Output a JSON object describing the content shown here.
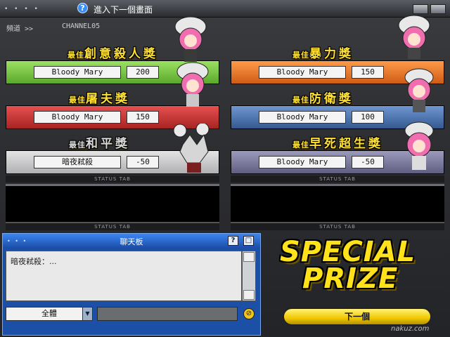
{
  "header": {
    "title": "進入下一個畫面",
    "dots": "• • • •"
  },
  "channel": {
    "label": "頻道 >>",
    "value": "CHANNEL05"
  },
  "left_awards": [
    {
      "title": "創意殺人獎",
      "prefix": "最佳",
      "name": "Bloody Mary",
      "score": "200",
      "color": "#7cc843",
      "tab": "STATUS TAB"
    },
    {
      "title": "屠夫獎",
      "prefix": "最佳",
      "name": "Bloody Mary",
      "score": "150",
      "color": "#cf3a3a",
      "tab": "STATUS TAB"
    },
    {
      "title": "和平獎",
      "prefix": "最佳",
      "name": "暗夜弒殺",
      "score": "-50",
      "color": "#cfcfd0",
      "tab": "STATUS TAB"
    }
  ],
  "right_awards": [
    {
      "title": "暴力獎",
      "prefix": "最佳",
      "name": "Bloody Mary",
      "score": "150",
      "color": "#f0782a",
      "tab": "STATUS TAB"
    },
    {
      "title": "防衛獎",
      "prefix": "最佳",
      "name": "Bloody Mary",
      "score": "100",
      "color": "#4e79b8",
      "tab": "STATUS TAB"
    },
    {
      "title": "早死超生獎",
      "prefix": "最佳",
      "name": "Bloody Mary",
      "score": "-50",
      "color": "#7e7d9e",
      "tab": "STATUS TAB"
    }
  ],
  "empty_panels": {
    "left_tab": "STATUS TAB",
    "right_tab": "STATUS TAB"
  },
  "chat": {
    "title": "聊天板",
    "help_button": "?",
    "close_button": "□",
    "message": "暗夜弒殺：...",
    "channel_select": "全體",
    "input_value": ""
  },
  "special_prize": {
    "line1": "SPECIAL",
    "line2": "PRIZE"
  },
  "next_button": "下一個",
  "credit": "nakuz.com"
}
